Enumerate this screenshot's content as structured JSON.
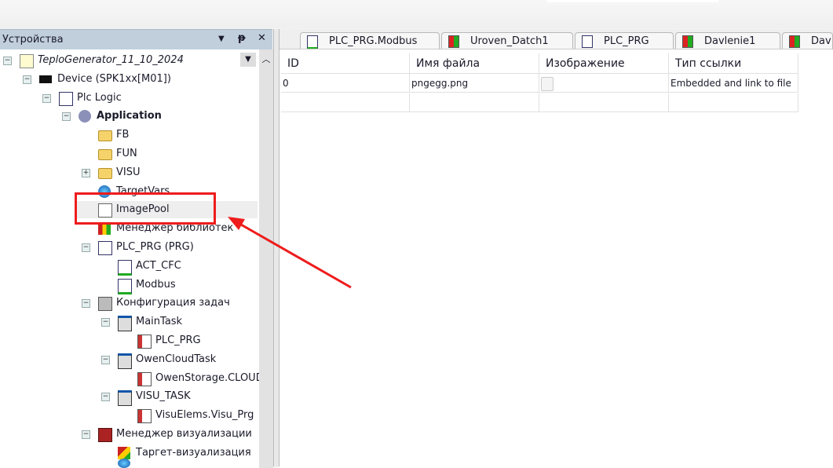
{
  "panel": {
    "title": "Устройства"
  },
  "tree": [
    {
      "level": 0,
      "label": "TeploGenerator_11_10_2024",
      "toggle": "minus",
      "icon": "project-icon",
      "style": "italic"
    },
    {
      "level": 1,
      "label": "Device (SPK1xx[M01])",
      "toggle": "minus",
      "icon": "device-icon"
    },
    {
      "level": 2,
      "label": "Plc Logic",
      "toggle": "minus",
      "icon": "plc-logic-icon"
    },
    {
      "level": 3,
      "label": "Application",
      "toggle": "minus",
      "icon": "gear-icon",
      "style": "bold"
    },
    {
      "level": 4,
      "label": "FB",
      "icon": "folder-icon"
    },
    {
      "level": 4,
      "label": "FUN",
      "icon": "folder-icon"
    },
    {
      "level": 4,
      "label": "VISU",
      "toggle": "plus",
      "icon": "folder-icon"
    },
    {
      "level": 4,
      "label": "TargetVars",
      "icon": "globe-icon"
    },
    {
      "level": 4,
      "label": "ImagePool",
      "icon": "image-pool-icon",
      "selected": true
    },
    {
      "level": 4,
      "label": "Менеджер библиотек",
      "icon": "library-icon"
    },
    {
      "level": 4,
      "label": "PLC_PRG (PRG)",
      "toggle": "minus",
      "icon": "program-icon"
    },
    {
      "level": 5,
      "label": "ACT_CFC",
      "icon": "action-icon"
    },
    {
      "level": 5,
      "label": "Modbus",
      "icon": "action-icon"
    },
    {
      "level": 4,
      "label": "Конфигурация задач",
      "toggle": "minus",
      "icon": "task-config-icon"
    },
    {
      "level": 5,
      "label": "MainTask",
      "toggle": "minus",
      "icon": "task-icon"
    },
    {
      "level": 6,
      "label": "PLC_PRG",
      "icon": "program-call-icon"
    },
    {
      "level": 5,
      "label": "OwenCloudTask",
      "toggle": "minus",
      "icon": "task-icon"
    },
    {
      "level": 6,
      "label": "OwenStorage.CLOUD",
      "icon": "program-call-icon"
    },
    {
      "level": 5,
      "label": "VISU_TASK",
      "toggle": "minus",
      "icon": "task-icon"
    },
    {
      "level": 6,
      "label": "VisuElems.Visu_Prg",
      "icon": "program-call-icon"
    },
    {
      "level": 4,
      "label": "Менеджер визуализации",
      "toggle": "minus",
      "icon": "visu-manager-icon"
    },
    {
      "level": 5,
      "label": "Таргет-визуализация",
      "icon": "target-visu-icon"
    }
  ],
  "tabs": [
    {
      "label": "PLC_PRG.Modbus",
      "icon": "action-icon"
    },
    {
      "label": "Uroven_Datch1",
      "icon": "visu-icon"
    },
    {
      "label": "PLC_PRG",
      "icon": "program-icon"
    },
    {
      "label": "Davlenie1",
      "icon": "visu-icon"
    },
    {
      "label": "Dav",
      "icon": "visu-icon"
    }
  ],
  "table": {
    "headers": [
      "ID",
      "Имя файла",
      "Изображение",
      "Тип ссылки"
    ],
    "rows": [
      [
        "0",
        "pngegg.png",
        "",
        "Embedded and link to file"
      ],
      [
        "",
        "",
        "",
        ""
      ]
    ]
  },
  "colors": {
    "highlight": "#ee1c1c",
    "panel_header": "#c1cfdc"
  }
}
